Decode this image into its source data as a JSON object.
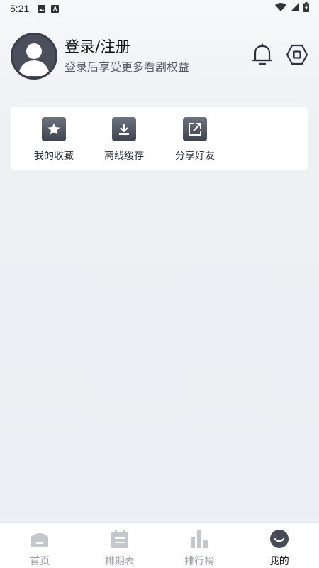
{
  "status_bar": {
    "time": "5:21",
    "icons": [
      "image-icon",
      "a-letter-icon",
      "wifi-icon",
      "signal-icon",
      "battery-icon"
    ],
    "a_glyph": "A"
  },
  "profile": {
    "title": "登录/注册",
    "subtitle": "登录后享受更多看剧权益",
    "avatar_icon": "user-avatar-icon"
  },
  "header_icons": [
    "bell-icon",
    "settings-hexagon-icon"
  ],
  "quick_actions": [
    {
      "label": "我的收藏",
      "icon": "star-icon"
    },
    {
      "label": "离线缓存",
      "icon": "download-icon"
    },
    {
      "label": "分享好友",
      "icon": "share-icon"
    }
  ],
  "bottom_nav": {
    "items": [
      {
        "label": "首页",
        "icon": "home-icon"
      },
      {
        "label": "排期表",
        "icon": "schedule-icon"
      },
      {
        "label": "排行榜",
        "icon": "ranking-icon"
      },
      {
        "label": "我的",
        "icon": "profile-icon"
      }
    ],
    "active": "我的"
  },
  "colors": {
    "background": "#eceef3",
    "card": "#ffffff",
    "icon_dark": "#3f434e",
    "nav_inactive": "#9a9da6",
    "nav_active": "#111111"
  }
}
